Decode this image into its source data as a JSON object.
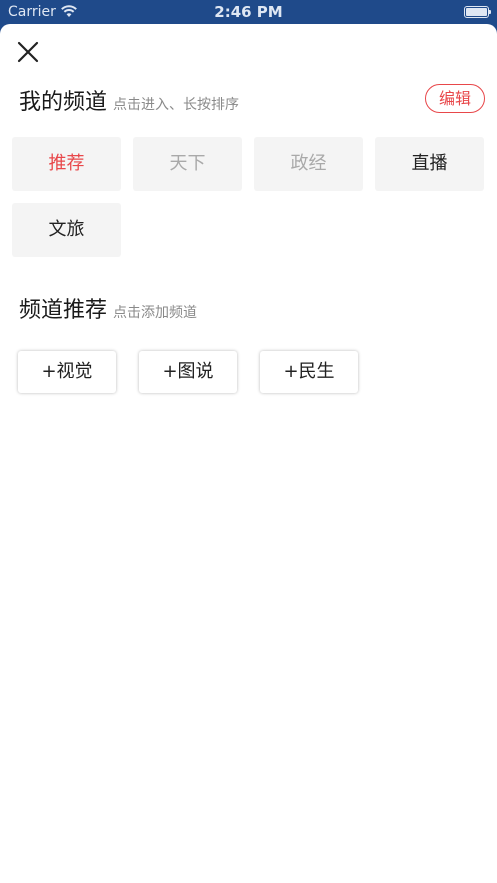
{
  "status_bar": {
    "carrier": "Carrier",
    "time": "2:46 PM"
  },
  "my_channels": {
    "title": "我的频道",
    "hint": "点击进入、长按排序",
    "edit_label": "编辑",
    "items": [
      {
        "label": "推荐",
        "state": "selected"
      },
      {
        "label": "天下",
        "state": "fixed"
      },
      {
        "label": "政经",
        "state": "fixed"
      },
      {
        "label": "直播",
        "state": "normal"
      },
      {
        "label": "文旅",
        "state": "normal"
      }
    ]
  },
  "recommended_channels": {
    "title": "频道推荐",
    "hint": "点击添加频道",
    "items": [
      {
        "label": "+视觉"
      },
      {
        "label": "+图说"
      },
      {
        "label": "+民生"
      }
    ]
  },
  "colors": {
    "accent": "#e8474a",
    "status_bar": "#1f4a8a",
    "tile_bg": "#f4f4f4",
    "muted_text": "#a9a9a9"
  },
  "icons": {
    "close": "close-icon",
    "wifi": "wifi-icon",
    "battery": "battery-icon"
  }
}
